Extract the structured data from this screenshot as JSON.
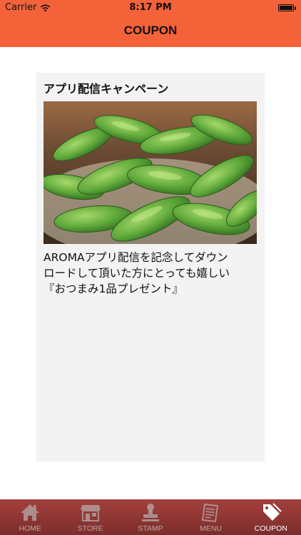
{
  "status_bar": {
    "carrier": "Carrier",
    "time": "8:17 PM",
    "wifi_icon": "wifi-icon",
    "battery_icon": "battery-icon"
  },
  "nav": {
    "title": "COUPON"
  },
  "coupon": {
    "title": "アプリ配信キャンペーン",
    "image": "edamame-photo",
    "body": "AROMAアプリ配信を記念してダウン\nロードして頂いた方にとっても嬉しい\n『おつまみ1品プレゼント』"
  },
  "tabs": [
    {
      "label": "HOME",
      "icon": "home-icon",
      "active": false
    },
    {
      "label": "STORE",
      "icon": "store-icon",
      "active": false
    },
    {
      "label": "STAMP",
      "icon": "stamp-icon",
      "active": false
    },
    {
      "label": "MENU",
      "icon": "menu-icon",
      "active": false
    },
    {
      "label": "COUPON",
      "icon": "tag-icon",
      "active": true
    }
  ],
  "colors": {
    "header": "#F4623A",
    "card_background": "#F3F3F3",
    "tabbar": "#8E3633",
    "tab_inactive": "#B6A9A8",
    "tab_active": "#FFFFFF"
  }
}
